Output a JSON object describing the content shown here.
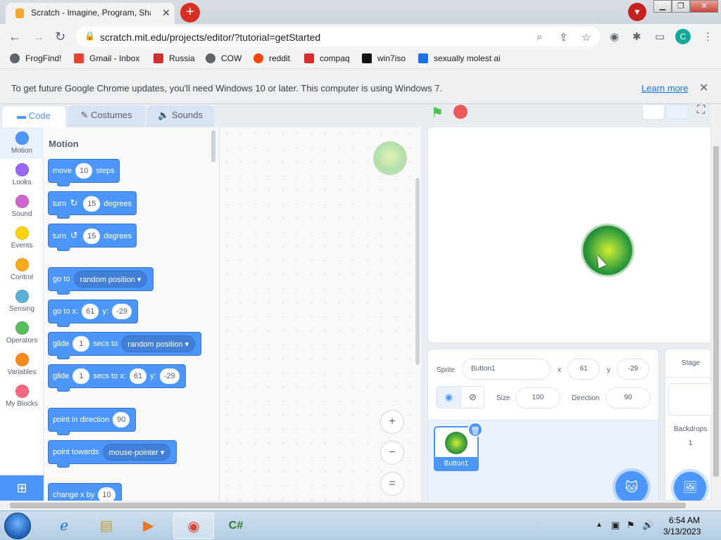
{
  "browser": {
    "tab_title": "Scratch - Imagine, Program, Share",
    "tab_close": "✕",
    "new_tab": "+",
    "url": "scratch.mit.edu/projects/editor/?tutorial=getStarted",
    "window_controls": [
      "▁",
      "❐",
      "✕"
    ],
    "bookmarks": [
      {
        "label": "FrogFind!",
        "icon": "globe-icon",
        "color": "#5f6368"
      },
      {
        "label": "Gmail - Inbox",
        "icon": "gmail-icon",
        "color": "#ea4335"
      },
      {
        "label": "Russia",
        "icon": "russia-icon",
        "color": "#d32f2f"
      },
      {
        "label": "COW",
        "icon": "globe-icon",
        "color": "#5f6368"
      },
      {
        "label": "reddit",
        "icon": "reddit-icon",
        "color": "#ff4500"
      },
      {
        "label": "compaq",
        "icon": "compaq-icon",
        "color": "#d32f2f"
      },
      {
        "label": "win7iso",
        "icon": "win7iso-icon",
        "color": "#111111"
      },
      {
        "label": "sexually molest ai",
        "icon": "ai-icon",
        "color": "#1a73e8"
      }
    ],
    "profile_initial": "C"
  },
  "infobar": {
    "message": "To get future Google Chrome updates, you'll need Windows 10 or later. This computer is using Windows 7.",
    "learn_more": "Learn more",
    "close": "✕"
  },
  "scratch": {
    "tabs": {
      "code": "Code",
      "costumes": "Costumes",
      "sounds": "Sounds"
    },
    "categories": [
      {
        "label": "Motion",
        "color": "#4c97ff"
      },
      {
        "label": "Looks",
        "color": "#9966ff"
      },
      {
        "label": "Sound",
        "color": "#cf63cf"
      },
      {
        "label": "Events",
        "color": "#ffd500"
      },
      {
        "label": "Control",
        "color": "#ffab19"
      },
      {
        "label": "Sensing",
        "color": "#5cb1d6"
      },
      {
        "label": "Operators",
        "color": "#59c059"
      },
      {
        "label": "Variables",
        "color": "#ff8c1a"
      },
      {
        "label": "My Blocks",
        "color": "#ff6680"
      }
    ],
    "palette": {
      "heading": "Motion",
      "move": {
        "pre": "move",
        "value": "10",
        "post": "steps"
      },
      "turn_right": {
        "pre": "turn",
        "icon": "↻",
        "value": "15",
        "post": "degrees"
      },
      "turn_left": {
        "pre": "turn",
        "icon": "↺",
        "value": "15",
        "post": "degrees"
      },
      "go_to": {
        "pre": "go to",
        "option": "random position ▾"
      },
      "go_to_xy": {
        "pre": "go to x:",
        "x": "61",
        "mid": "y:",
        "y": "-29"
      },
      "glide_to": {
        "pre": "glide",
        "secs": "1",
        "mid": "secs to",
        "option": "random position ▾"
      },
      "glide_xy": {
        "pre": "glide",
        "secs": "1",
        "mid": "secs to x:",
        "x": "61",
        "mid2": "y:",
        "y": "-29"
      },
      "point_direction": {
        "pre": "point in direction",
        "value": "90"
      },
      "point_towards": {
        "pre": "point towards",
        "option": "mouse-pointer ▾"
      },
      "change_x": {
        "pre": "change x by",
        "value": "10"
      }
    },
    "zoom": {
      "in": "+",
      "out": "−",
      "reset": "="
    },
    "sprite_info": {
      "sprite_label": "Sprite",
      "sprite_name": "Button1",
      "x_label": "x",
      "x_value": "61",
      "y_label": "y",
      "y_value": "-29",
      "show_on": "◉",
      "show_off": "⊘",
      "size_label": "Size",
      "size_value": "100",
      "direction_label": "Direction",
      "direction_value": "90"
    },
    "sprite_thumb_name": "Button1",
    "stage_panel": {
      "title": "Stage",
      "backdrops_label": "Backdrops",
      "backdrops_count": "1"
    }
  },
  "taskbar": {
    "time": "6:54 AM",
    "date": "3/13/2023"
  }
}
